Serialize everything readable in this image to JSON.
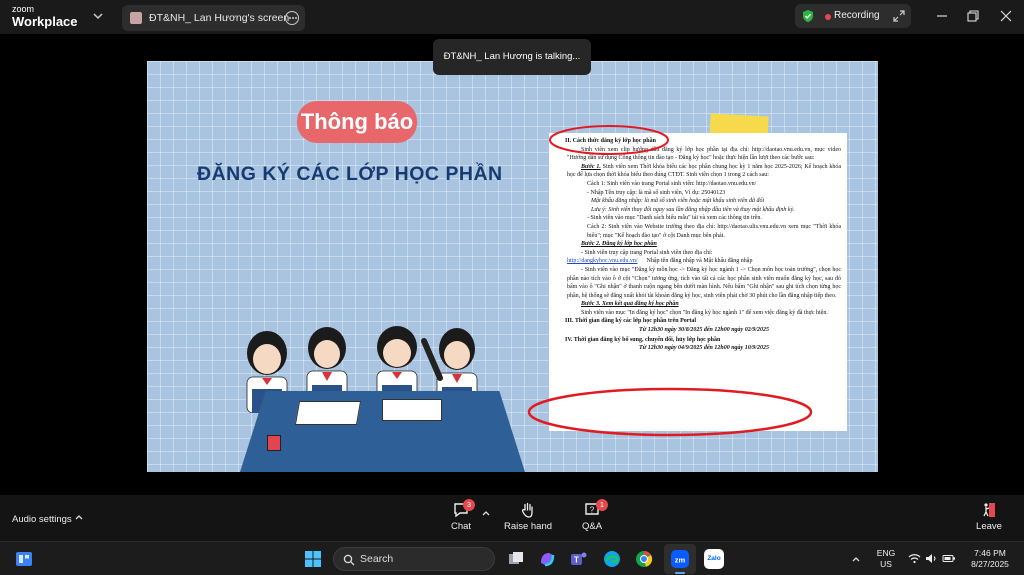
{
  "app": {
    "name_line1": "zoom",
    "name_line2": "Workplace"
  },
  "tab": {
    "title": "ĐT&NH_ Lan Hương's screen"
  },
  "recording": {
    "label": "Recording"
  },
  "talking_indicator": "ĐT&NH_ Lan Hương is talking...",
  "slide": {
    "badge": "Thông báo",
    "headline": "ĐĂNG KÝ CÁC LỚP HỌC PHẦN",
    "doc": {
      "s2_title": "II. Cách thức đăng ký lớp học phần",
      "p1": "Sinh viên xem clip hướng dẫn đăng ký lớp học phần tại địa chỉ: http://daotao.vnu.edu.vn, mục video \"Hướng dẫn sử dụng Cổng thông tin đào tạo - Đăng ký học\" hoặc thực hiện lần lượt theo các bước sau:",
      "b1_label": "Bước 1.",
      "b1_text": " Sinh viên xem Thời khóa biểu các học phần chung học kỳ 1 năm học 2025-2026; Kế hoạch khóa học để lựa chọn thời khóa biểu theo đúng CTĐT. Sinh viên chọn 1 trong 2 cách sau:",
      "c1": "Cách 1: Sinh viên vào trang Portal sinh viên: http://daotao.vnu.edu.vn/",
      "c1_user": "- Nhập Tên truy cập:           là mã số sinh viên,           Ví dụ: 25040123",
      "c1_pass": "Mật khẩu đăng nhập:          là mã số sinh viên hoặc mật khẩu sinh viên đã đổi",
      "c1_note": "Lưu ý: Sinh viên thay đổi ngay sau lần đăng nhập đầu tiên và thay mật khẩu định kỳ.",
      "c1_menu": "- Sinh viên vào mục \"Danh sách biểu mẫu\" tải và xem các thông tin trên.",
      "c2": "Cách 2: Sinh viên vào Website trường theo địa chỉ: http://daotao.ulis.vnu.edu.vn xem mục \"Thời khóa biểu\"; mục \"Kế hoạch đào tạo\" ở cột Danh mục bên phải.",
      "b2": "Bước 2. Đăng ký lớp học phần",
      "b2_a": "- Sinh viên truy cập trang Portal sinh viên theo địa chỉ:",
      "b2_link": "http://dangkyhoc.vnu.edu.vn/",
      "b2_login": "Nhập tên đăng nhập và Mật khẩu đăng nhập",
      "b2_text": "- Sinh viên vào mục \"Đăng ký môn học -> Đăng ký học ngành 1 -> Chọn môn học toàn trường\", chọn học phần nào tích vào ô ở cột \"Chọn\" tương ứng, tích vào tất cả các học phần sinh viên muốn đăng ký học, sau đó bấm vào ô \"Ghi nhận\" ở thanh cuộn ngang bên dưới màn hình. Nếu bấm \"Ghi nhận\" sau ghi tích chọn từng học phần, hệ thống sẽ đăng xuất khỏi tài khoản đăng ký học, sinh viên phải chờ 30 phút cho lần đăng nhập tiếp theo.",
      "b3": "Bước 3. Xem kết quả đăng ký học phần",
      "b3_text": "Sinh viên vào mục \"In đăng ký học\" chọn \"In đăng ký học ngành 1\" để xem việc đăng ký đã thực hiện.",
      "s3_title": "III. Thời gian đăng ký các lớp học phần trên Portal",
      "s3_time": "Từ 12h30 ngày 30/8/2025 đến 12h00 ngày 02/9/2025",
      "s4_title": "IV. Thời gian đăng ký bổ sung, chuyển đổi, hủy lớp học phần",
      "s4_time": "Từ 12h30 ngày 04/9/2025 đến 12h00 ngày 10/9/2025"
    }
  },
  "toolbar": {
    "audio_settings": "Audio settings",
    "chat_label": "Chat",
    "chat_badge": "3",
    "raise_hand_label": "Raise hand",
    "qa_label": "Q&A",
    "qa_badge": "1",
    "leave_label": "Leave"
  },
  "taskbar": {
    "search_placeholder": "Search",
    "zalo_label": "Zalo",
    "lang_line1": "ENG",
    "lang_line2": "US",
    "time": "7:46 PM",
    "date": "8/27/2025"
  },
  "colors": {
    "accent_red": "#e5484d",
    "slide_blue": "#a9c4e0",
    "badge_pink": "#e8676b",
    "headline_navy": "#173a72"
  },
  "icons": [
    "chevron-down-icon",
    "shield-check-icon",
    "expand-icon",
    "minimize-icon",
    "restore-icon",
    "close-icon",
    "chat-icon",
    "raise-hand-icon",
    "qa-icon",
    "leave-icon",
    "windows-start-icon",
    "search-icon",
    "wifi-icon",
    "volume-icon",
    "battery-icon"
  ]
}
